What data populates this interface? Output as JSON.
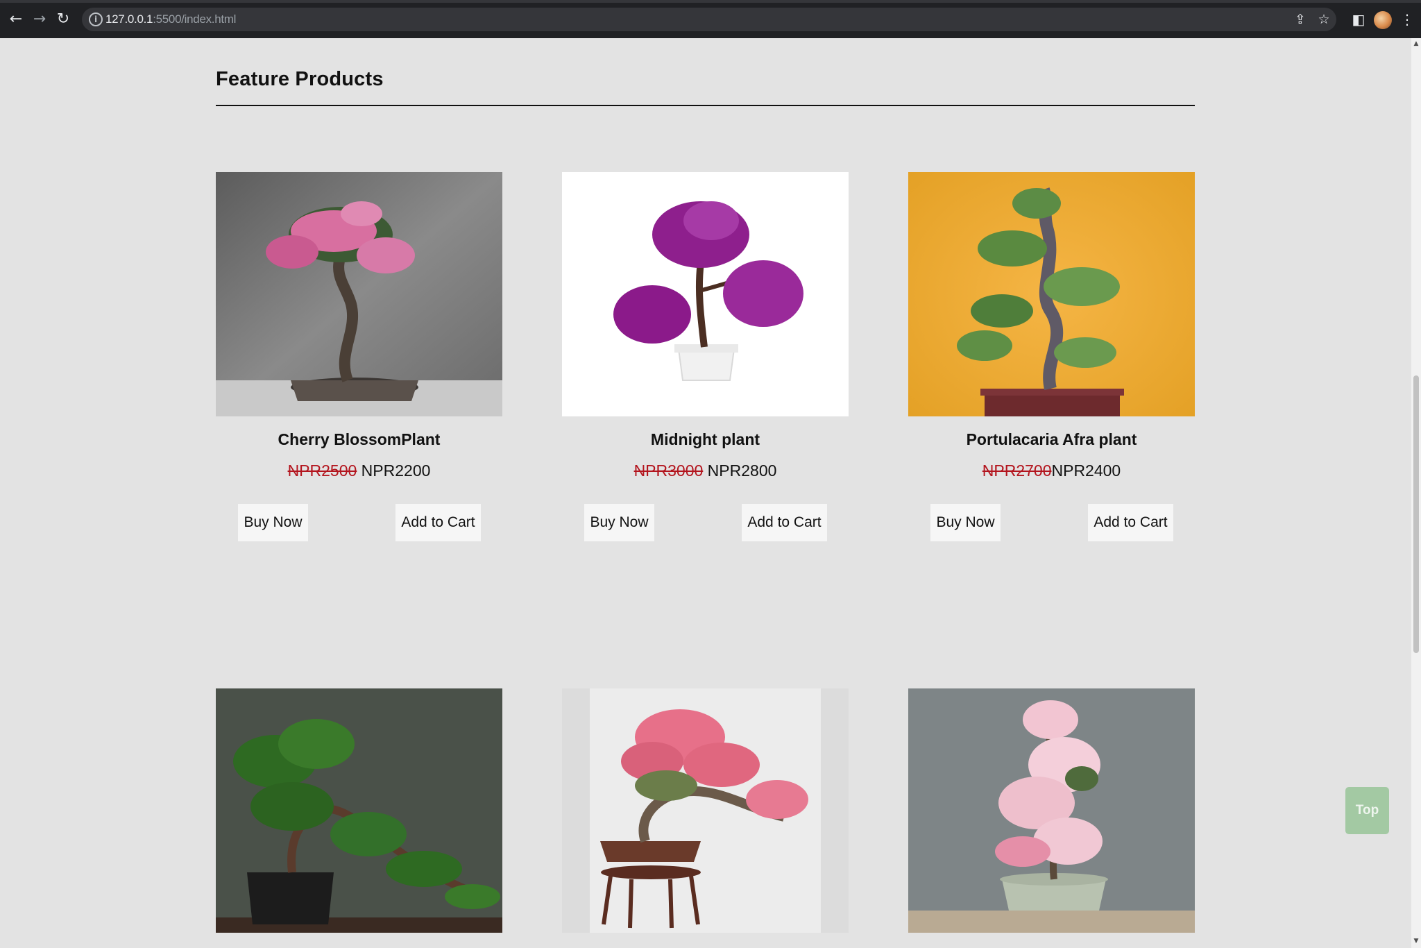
{
  "browser": {
    "url_host": "127.0.0.1",
    "url_rest": ":5500/index.html",
    "back_glyph": "←",
    "forward_glyph": "→",
    "reload_glyph": "↻",
    "info_glyph": "i",
    "share_glyph": "⇪",
    "star_glyph": "☆",
    "sidepanel_glyph": "◧",
    "menu_glyph": "⋮"
  },
  "section": {
    "title": "Feature Products"
  },
  "products": [
    {
      "name": "Cherry BlossomPlant",
      "old_price": "NPR2500",
      "new_price": " NPR2200",
      "buy": "Buy Now",
      "cart": "Add to Cart"
    },
    {
      "name": "Midnight plant",
      "old_price": "NPR3000",
      "new_price": " NPR2800",
      "buy": "Buy Now",
      "cart": "Add to Cart"
    },
    {
      "name": "Portulacaria Afra plant",
      "old_price": "NPR2700",
      "new_price": "NPR2400",
      "buy": "Buy Now",
      "cart": "Add to Cart"
    }
  ],
  "top_button": "Top",
  "colors": {
    "page_bg": "#e3e3e3",
    "old_price": "#b3141d",
    "top_button_bg": "#a3c9a3"
  }
}
